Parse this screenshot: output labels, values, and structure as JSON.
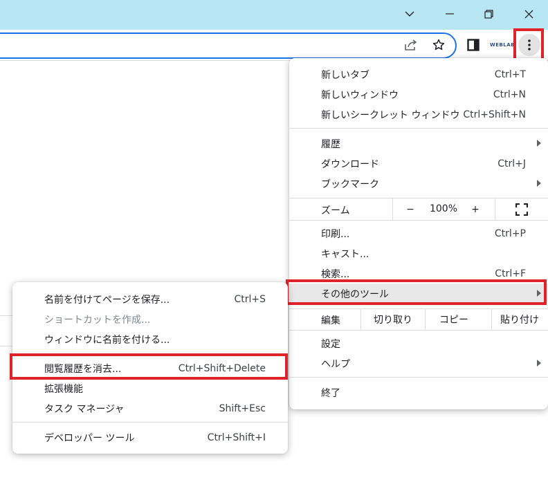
{
  "toolbar": {
    "extension_label": "WEBLAB"
  },
  "main_menu": {
    "items": [
      {
        "label": "新しいタブ",
        "shortcut": "Ctrl+T"
      },
      {
        "label": "新しいウィンドウ",
        "shortcut": "Ctrl+N"
      },
      {
        "label": "新しいシークレット ウィンドウ",
        "shortcut": "Ctrl+Shift+N"
      },
      {
        "label": "履歴",
        "shortcut": ""
      },
      {
        "label": "ダウンロード",
        "shortcut": "Ctrl+J"
      },
      {
        "label": "ブックマーク",
        "shortcut": ""
      },
      {
        "label": "印刷...",
        "shortcut": "Ctrl+P"
      },
      {
        "label": "キャスト...",
        "shortcut": ""
      },
      {
        "label": "検索...",
        "shortcut": "Ctrl+F"
      },
      {
        "label": "その他のツール",
        "shortcut": ""
      },
      {
        "label": "設定",
        "shortcut": ""
      },
      {
        "label": "ヘルプ",
        "shortcut": ""
      },
      {
        "label": "終了",
        "shortcut": ""
      }
    ],
    "zoom": {
      "label": "ズーム",
      "minus": "−",
      "value": "100%",
      "plus": "+"
    },
    "edit": {
      "label": "編集",
      "cut": "切り取り",
      "copy": "コピー",
      "paste": "貼り付け"
    }
  },
  "sub_menu": {
    "items": [
      {
        "label": "名前を付けてページを保存...",
        "shortcut": "Ctrl+S"
      },
      {
        "label": "ショートカットを作成...",
        "shortcut": ""
      },
      {
        "label": "ウィンドウに名前を付ける...",
        "shortcut": ""
      },
      {
        "label": "閲覧履歴を消去...",
        "shortcut": "Ctrl+Shift+Delete"
      },
      {
        "label": "拡張機能",
        "shortcut": ""
      },
      {
        "label": "タスク マネージャ",
        "shortcut": "Shift+Esc"
      },
      {
        "label": "デベロッパー ツール",
        "shortcut": "Ctrl+Shift+I"
      }
    ]
  },
  "colors": {
    "highlight_box": "#e0222b",
    "titlebar": "#b8e6f2",
    "focus_ring": "#1a73e8"
  }
}
